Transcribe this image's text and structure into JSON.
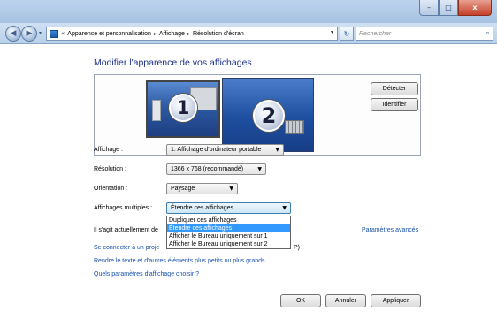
{
  "window": {
    "caption_buttons": {
      "minimize": "–",
      "maximize": "□",
      "close": "x"
    }
  },
  "navbar": {
    "back_icon": "◀",
    "forward_icon": "▶",
    "history_dropdown_icon": "▾",
    "address": {
      "prefix": "«",
      "crumbs": [
        "Apparence et personnalisation",
        "Affichage",
        "Résolution d'écran"
      ],
      "separator": "▸",
      "dropdown_icon": "▾"
    },
    "refresh_icon": "↻",
    "search": {
      "placeholder": "Rechercher",
      "icon": "⌕"
    }
  },
  "main": {
    "title": "Modifier l'apparence de vos affichages",
    "monitors": [
      {
        "number": "1",
        "selected": true
      },
      {
        "number": "2",
        "selected": false
      }
    ],
    "detect_label": "Détecter",
    "identify_label": "Identifier",
    "fields": {
      "display": {
        "label": "Affichage :",
        "value": "1. Affichage d'ordinateur portable"
      },
      "resolution": {
        "label": "Résolution :",
        "value": "1366 x 768 (recommandé)"
      },
      "orientation": {
        "label": "Orientation :",
        "value": "Paysage"
      },
      "multiple_displays": {
        "label": "Affichages multiples :",
        "value": "Étendre ces affichages",
        "options": [
          "Dupliquer ces affichages",
          "Étendre ces affichages",
          "Afficher le Bureau uniquement sur 1",
          "Afficher le Bureau uniquement sur 2"
        ],
        "selected_index": 1
      }
    },
    "current_display_text_start": "Il s'agit actuellement de",
    "current_display_text_end": "P)",
    "advanced_link": "Paramètres avancés",
    "links": {
      "connect_projector_visible": "Se connecter à un proje",
      "text_size": "Rendre le texte et d'autres éléments plus petits ou plus grands",
      "which_settings": "Quels paramètres d'affichage choisir ?"
    },
    "buttons": {
      "ok": "OK",
      "cancel": "Annuler",
      "apply": "Appliquer"
    },
    "dropdown_arrow": "▼"
  },
  "colors": {
    "title_blue": "#1e3287",
    "link_blue": "#1a53b0",
    "selection_blue": "#3399ff",
    "close_red": "#c5422a"
  }
}
